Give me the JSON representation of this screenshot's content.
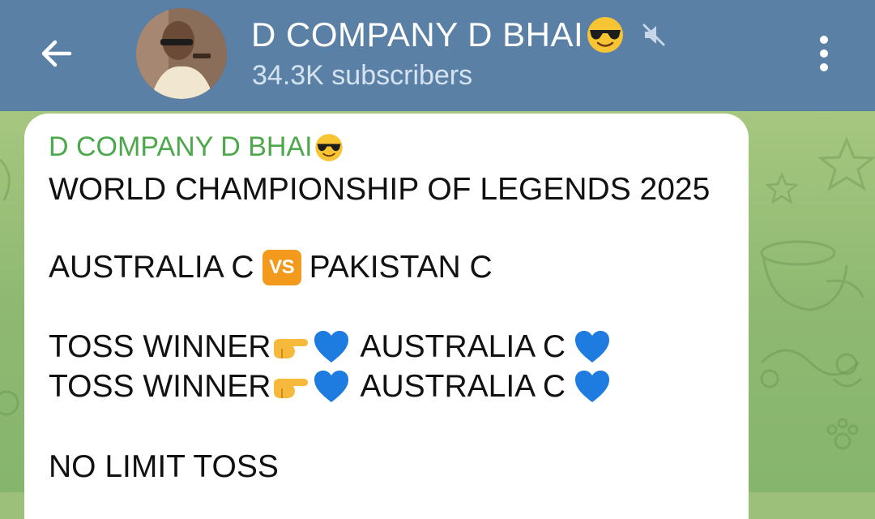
{
  "header": {
    "channel_name": "D COMPANY D BHAI",
    "subscribers": "34.3K subscribers"
  },
  "message": {
    "sender": "D COMPANY D BHAI",
    "title_line": "WORLD CHAMPIONSHIP OF LEGENDS 2025",
    "team_a": "AUSTRALIA C",
    "vs_label": "VS",
    "team_b": "PAKISTAN C",
    "toss_lines": [
      {
        "label": "TOSS WINNER",
        "team": "AUSTRALIA C"
      },
      {
        "label": "TOSS WINNER",
        "team": "AUSTRALIA C"
      }
    ],
    "footer_line": "NO LIMIT TOSS"
  },
  "colors": {
    "header_bg": "#5b80a6",
    "sender_name": "#4ca84a",
    "chat_bg": "#9cc07a",
    "vs_badge": "#f39a1c",
    "heart": "#1e7be0"
  },
  "icons": {
    "back": "arrow-left-icon",
    "mute": "mute-icon",
    "menu": "kebab-menu-icon",
    "sunglasses": "sunglasses-emoji-icon",
    "pointing": "pointing-right-emoji-icon",
    "heart": "blue-heart-emoji-icon"
  }
}
